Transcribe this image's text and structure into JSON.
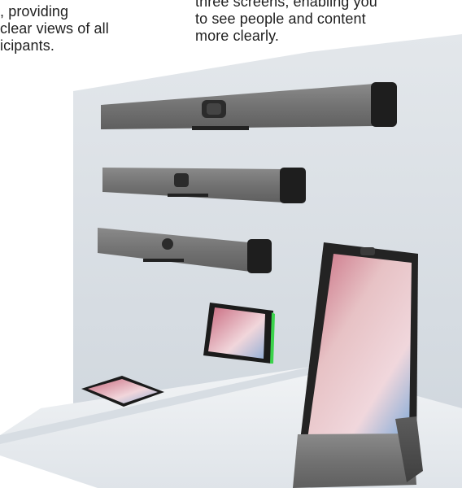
{
  "captions": {
    "left": ", providing\nclear views of all\nicipants.",
    "right": "three screens, enabling you\nto see people and content\nmore clearly."
  },
  "colors": {
    "wall": "#d8dde2",
    "shelf": "#eceff2",
    "bar_fabric": "#6d6d6d",
    "bar_cap": "#1c1c1c",
    "screen_gradient": [
      "#d07b90",
      "#e9c3c6",
      "#9fb3cf"
    ]
  },
  "devices": [
    {
      "name": "large-video-bar"
    },
    {
      "name": "medium-video-bar"
    },
    {
      "name": "small-video-bar"
    },
    {
      "name": "wall-touch-panel"
    },
    {
      "name": "table-touch-panel"
    },
    {
      "name": "desk-device-screen"
    }
  ]
}
